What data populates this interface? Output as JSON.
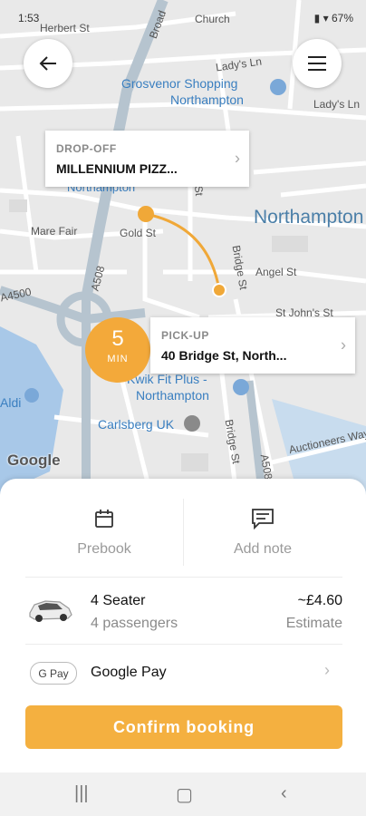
{
  "status_bar": {
    "time": "1:53",
    "battery": "67%"
  },
  "map": {
    "streets": [
      "Herbert St",
      "Lady's Ln",
      "Lady's Ln",
      "Mare Fair",
      "Gold St",
      "Angel St",
      "St John's St",
      "A508",
      "A508",
      "Bridge St",
      "Bridge St",
      "Auctioneers Way",
      "Broad",
      "Church",
      "A4500",
      "Fetter St"
    ],
    "pois": [
      "Grosvenor Shopping",
      "Northampton",
      "Kwik Fit Plus -",
      "Northampton",
      "Carlsberg UK",
      "Northampton",
      "Northampton",
      "Aldi"
    ],
    "attribution": "Google"
  },
  "dropoff": {
    "caption": "DROP-OFF",
    "value": "MILLENNIUM PIZZ..."
  },
  "pickup": {
    "caption": "PICK-UP",
    "value": "40 Bridge St, North..."
  },
  "eta": {
    "number": "5",
    "unit": "MIN"
  },
  "options": {
    "prebook": "Prebook",
    "note": "Add note"
  },
  "ride": {
    "name": "4 Seater",
    "passengers": "4 passengers",
    "price": "~£4.60",
    "price_note": "Estimate"
  },
  "payment": {
    "badge": "G Pay",
    "label": "Google Pay"
  },
  "confirm_label": "Confirm booking",
  "colors": {
    "accent": "#f4b040",
    "route": "#f0a838"
  }
}
